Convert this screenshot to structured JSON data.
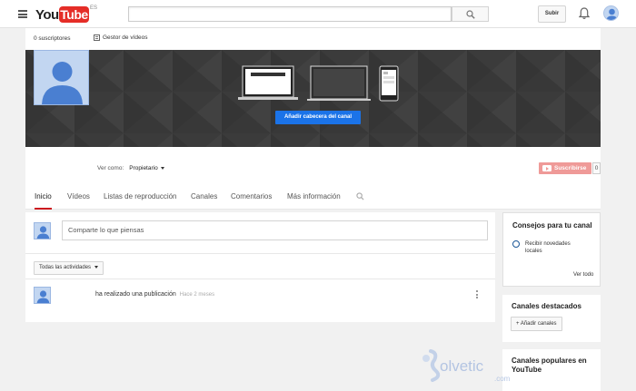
{
  "masthead": {
    "logo_you": "You",
    "logo_tube": "Tube",
    "logo_region": "ES",
    "search_placeholder": "",
    "upload_label": "Subir"
  },
  "channel": {
    "subscribers": "0 suscriptores",
    "video_manager": "Gestor de vídeos",
    "add_header_button": "Añadir cabecera del canal",
    "view_as_label": "Ver como:",
    "view_as_value": "Propietario",
    "subscribe_label": "Suscribirse",
    "subscriber_count": "0"
  },
  "tabs": [
    {
      "label": "Inicio",
      "active": true
    },
    {
      "label": "Vídeos",
      "active": false
    },
    {
      "label": "Listas de reproducción",
      "active": false
    },
    {
      "label": "Canales",
      "active": false
    },
    {
      "label": "Comentarios",
      "active": false
    },
    {
      "label": "Más información",
      "active": false
    }
  ],
  "feed": {
    "share_placeholder": "Comparte lo que piensas",
    "activity_filter": "Todas las actividades",
    "post_text": "ha realizado una publicación",
    "post_time": "Hace 2 meses"
  },
  "sidebar": {
    "tips_title": "Consejos para tu canal",
    "tip_text": "Recibir novedades locales",
    "see_all": "Ver todo",
    "featured_title": "Canales destacados",
    "add_channels": "+ Añadir canales",
    "popular_title": "Canales populares en YouTube"
  },
  "watermark": {
    "text": "olvetic",
    "suffix": ".com"
  },
  "colors": {
    "accent_blue": "#1b73e8",
    "youtube_red": "#e52d27",
    "subscribe_disabled": "#ef9a98",
    "banner_dark": "#3b3b3b"
  }
}
